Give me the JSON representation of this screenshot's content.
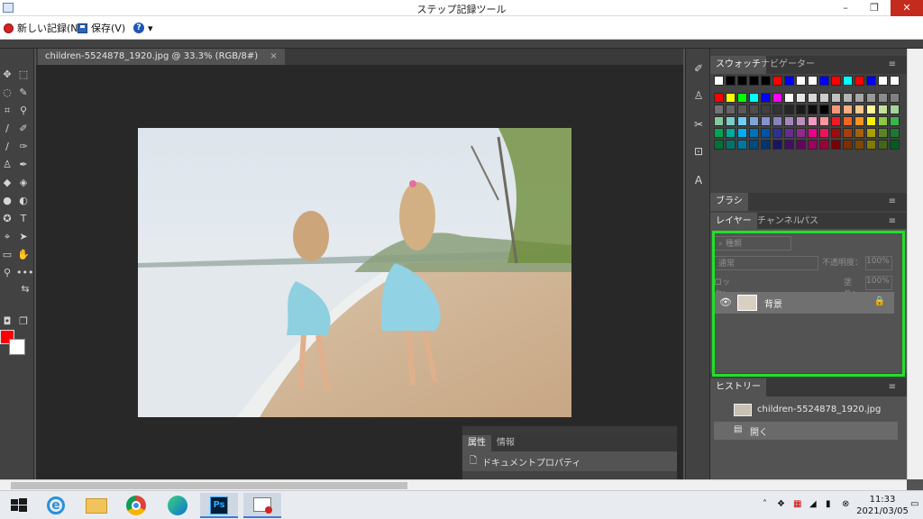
{
  "window": {
    "title": "ステップ記録ツール",
    "min": "–",
    "max": "❐",
    "close": "✕"
  },
  "recorder": {
    "new_record": "新しい記録(N)",
    "save": "保存(V)",
    "help": "?",
    "dropdown": "▾"
  },
  "document": {
    "tab_title": "children-5524878_1920.jpg @ 33.3% (RGB/8#)",
    "tab_close": "×"
  },
  "properties_panel": {
    "tabs": [
      "属性",
      "情報"
    ],
    "row_label": "ドキュメントプロパティ"
  },
  "swatches_panel": {
    "tabs": [
      "スウォッチ",
      "ナビゲーター"
    ],
    "colors": [
      [
        "#ffffff",
        "#000000",
        "#000000",
        "#000000",
        "#000000",
        "#ff0000",
        "#0000ff",
        "#ffffff",
        "#ffffff",
        "#0000ff",
        "#ff0000",
        "#00ffff",
        "#ff0000",
        "#0000ff",
        "#ffffff",
        "#ffffff"
      ],
      [
        "#ff0000",
        "#ffff00",
        "#00ff00",
        "#00ffff",
        "#0000ff",
        "#ff00ff",
        "#ffffff",
        "#e6e6e6",
        "#d9d9d9",
        "#cccccc",
        "#bfbfbf",
        "#b3b3b3",
        "#a6a6a6",
        "#999999",
        "#8c8c8c",
        "#808080"
      ],
      [
        "#737373",
        "#666666",
        "#595959",
        "#4d4d4d",
        "#404040",
        "#333333",
        "#262626",
        "#1a1a1a",
        "#0d0d0d",
        "#000000",
        "#f7977a",
        "#f9ad81",
        "#fdc68a",
        "#fff79a",
        "#c4df9b",
        "#a2d39c"
      ],
      [
        "#82ca9d",
        "#7bcdc8",
        "#6ecff6",
        "#7ea7d8",
        "#8493ca",
        "#8882be",
        "#a187be",
        "#bc8dbf",
        "#f49ac2",
        "#f6989d",
        "#ed1c24",
        "#f26522",
        "#f7941d",
        "#fff200",
        "#8dc73f",
        "#39b54a"
      ],
      [
        "#00a651",
        "#00a99d",
        "#00aeef",
        "#0072bc",
        "#0054a6",
        "#2e3192",
        "#662d91",
        "#92278f",
        "#ec008c",
        "#ed145b",
        "#9e0b0f",
        "#a0410d",
        "#a36209",
        "#aba000",
        "#598527",
        "#1a7b30"
      ],
      [
        "#007236",
        "#00746b",
        "#0076a3",
        "#004b80",
        "#003471",
        "#1b1464",
        "#440e62",
        "#630460",
        "#9e005d",
        "#9e0039",
        "#790000",
        "#7b2e00",
        "#7d4900",
        "#827b00",
        "#406618",
        "#005e20"
      ]
    ]
  },
  "brush_panel": {
    "tabs": [
      "ブラシ"
    ]
  },
  "layers_panel": {
    "tabs": [
      "レイヤー",
      "チャンネル",
      "パス"
    ],
    "filter_placeholder": "種類",
    "blend_mode": "通常",
    "opacity_label": "不透明度：",
    "opacity_value": "100%",
    "lock_label": "ロック：",
    "fill_label": "塗り：",
    "fill_value": "100%",
    "layer_name": "背景"
  },
  "history_panel": {
    "tabs": [
      "ヒストリー"
    ],
    "items": [
      {
        "label": "children-5524878_1920.jpg"
      },
      {
        "label": "開く"
      }
    ]
  },
  "taskbar": {
    "time": "11:33",
    "date": "2021/03/05"
  }
}
